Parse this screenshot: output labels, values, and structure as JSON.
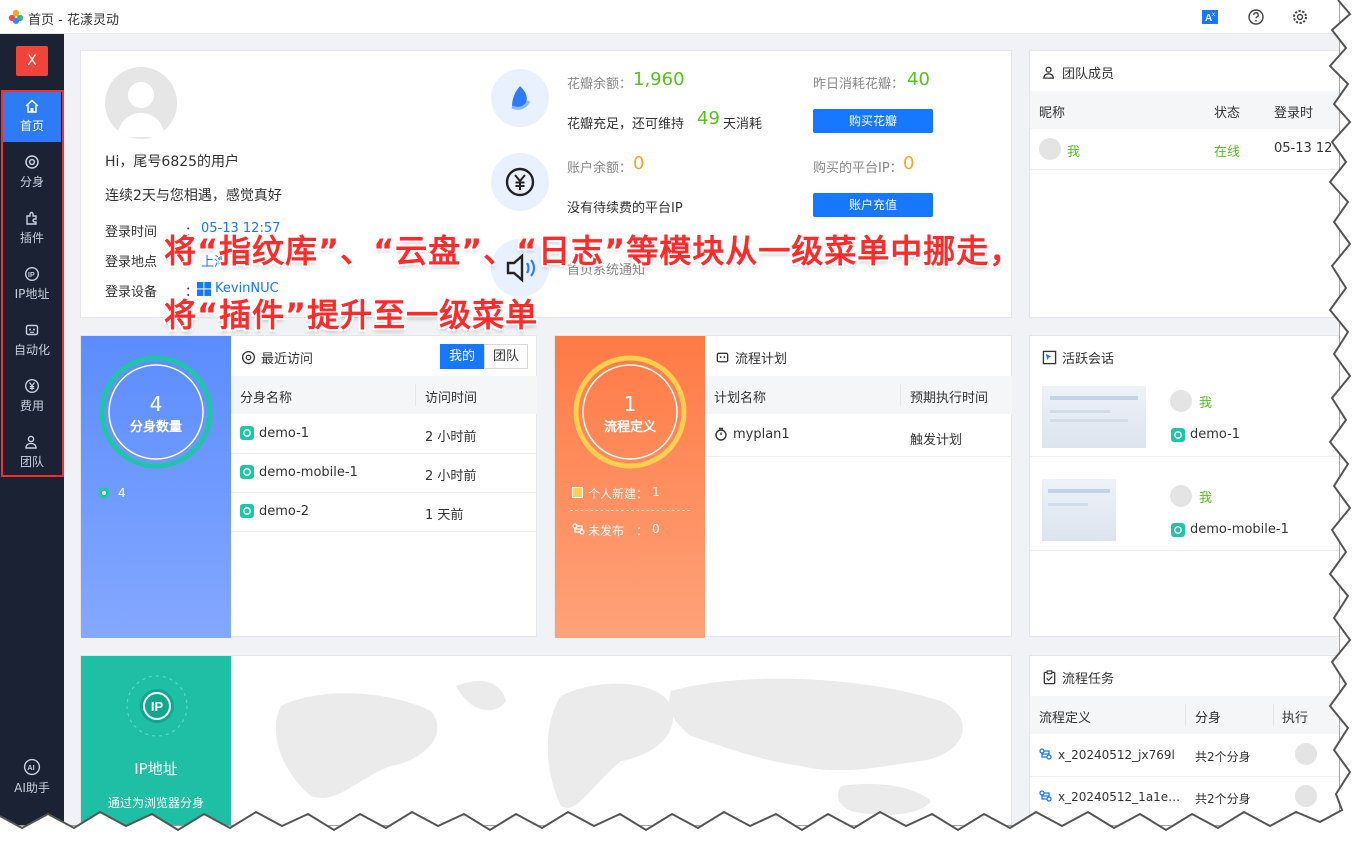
{
  "window": {
    "title": "首页 - 花漾灵动"
  },
  "sidebar": {
    "close_label": "X",
    "items": [
      {
        "label": "首页",
        "icon": "home-icon",
        "active": true
      },
      {
        "label": "分身",
        "icon": "browser-icon",
        "active": false
      },
      {
        "label": "插件",
        "icon": "puzzle-icon",
        "active": false
      },
      {
        "label": "IP地址",
        "icon": "ip-icon",
        "active": false
      },
      {
        "label": "自动化",
        "icon": "robot-icon",
        "active": false
      },
      {
        "label": "费用",
        "icon": "yen-icon",
        "active": false
      },
      {
        "label": "团队",
        "icon": "team-icon",
        "active": false
      }
    ],
    "ai_label": "AI助手",
    "ai_icon_text": "AI"
  },
  "profile": {
    "greeting": "Hi，尾号6825的用户",
    "days_text": "连续2天与您相遇，感觉真好",
    "login_time_label": "登录时间",
    "login_time_value": "05-13 12:57",
    "login_place_label": "登录地点",
    "login_place_value": "上海",
    "login_device_label": "登录设备",
    "login_device_value": "KevinNUC",
    "colon": "："
  },
  "balance": {
    "petal_label": "花瓣余额：",
    "petal_value": "1,960",
    "petal_note_pre": "花瓣充足，还可维持",
    "petal_days": "49",
    "petal_note_post": "天消耗",
    "yesterday_label": "昨日消耗花瓣：",
    "yesterday_value": "40",
    "buy_button": "购买花瓣",
    "account_label": "账户余额：",
    "account_value": "0",
    "ip_label": "购买的平台IP：",
    "ip_value": "0",
    "renew_note": "没有待续费的平台IP",
    "recharge_button": "账户充值",
    "notice_text": "首页系统通知"
  },
  "annotation": {
    "line1": "将“指纹库”、“云盘”、“日志”等模块从一级菜单中挪走，",
    "line2": "将“插件”提升至一级菜单"
  },
  "profiles_card": {
    "count": "4",
    "count_label": "分身数量",
    "footer_count": "4",
    "title": "最近访问",
    "tab_mine": "我的",
    "tab_team": "团队",
    "col_name": "分身名称",
    "col_time": "访问时间",
    "rows": [
      {
        "name": "demo-1",
        "time": "2 小时前"
      },
      {
        "name": "demo-mobile-1",
        "time": "2 小时前"
      },
      {
        "name": "demo-2",
        "time": "1 天前"
      }
    ]
  },
  "flow_card": {
    "count": "1",
    "count_label": "流程定义",
    "personal_label": "个人新建：",
    "personal_value": "1",
    "unpublished_label": "未发布",
    "unpublished_value": "0",
    "colon": "：",
    "title": "流程计划",
    "col_name": "计划名称",
    "col_time": "预期执行时间",
    "rows": [
      {
        "name": "myplan1",
        "time": "触发计划"
      }
    ]
  },
  "team": {
    "title": "团队成员",
    "col_nick": "昵称",
    "col_status": "状态",
    "col_login": "登录时",
    "rows": [
      {
        "name": "我",
        "status": "在线",
        "login": "05-13 12"
      }
    ]
  },
  "sessions": {
    "title": "活跃会话",
    "items": [
      {
        "user": "我",
        "profile": "demo-1"
      },
      {
        "user": "我",
        "profile": "demo-mobile-1"
      }
    ]
  },
  "ip_card": {
    "title": "IP地址",
    "subtitle": "通过为浏览器分身",
    "icon_text": "IP"
  },
  "tasks": {
    "title": "流程任务",
    "col_def": "流程定义",
    "col_profile": "分身",
    "col_exec": "执行",
    "rows": [
      {
        "def": "x_20240512_jx769l",
        "profile": "共2个分身"
      },
      {
        "def": "x_20240512_1a1e…",
        "profile": "共2个分身"
      }
    ]
  },
  "colors": {
    "sidebar_bg": "#1b2233",
    "accent_blue": "#2d7cf6",
    "annotation_red": "#ff2b2b",
    "profiles_card": "#5b8cff",
    "flow_card": "#ff7d4d",
    "ip_card": "#1fbfa5",
    "green": "#52c41a"
  }
}
